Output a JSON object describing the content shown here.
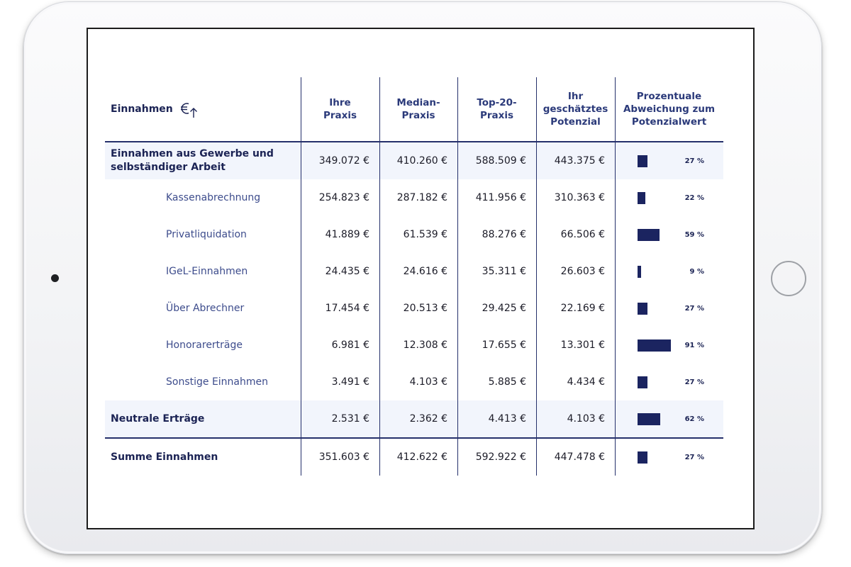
{
  "table": {
    "headers": {
      "first": "Einnahmen",
      "icon": "euro-up-arrow-icon",
      "columns": [
        [
          "Ihre",
          "Praxis"
        ],
        [
          "Median-",
          "Praxis"
        ],
        [
          "Top-20-",
          "Praxis"
        ],
        [
          "Ihr",
          "geschätztes",
          "Potenzial"
        ],
        [
          "Prozentuale",
          "Abweichung zum",
          "Potenzialwert"
        ]
      ]
    },
    "rows": [
      {
        "label": "Einnahmen aus Gewerbe und selbständiger Arbeit",
        "type": "group",
        "values": [
          "349.072 €",
          "410.260 €",
          "588.509 €",
          "443.375 €"
        ],
        "pct_value": 27,
        "pct": "27 %"
      },
      {
        "label": "Kassenabrechnung",
        "type": "sub",
        "values": [
          "254.823 €",
          "287.182 €",
          "411.956 €",
          "310.363 €"
        ],
        "pct_value": 22,
        "pct": "22 %"
      },
      {
        "label": "Privatliquidation",
        "type": "sub",
        "values": [
          "41.889 €",
          "61.539 €",
          "88.276 €",
          "66.506 €"
        ],
        "pct_value": 59,
        "pct": "59 %"
      },
      {
        "label": "IGeL-Einnahmen",
        "type": "sub",
        "values": [
          "24.435 €",
          "24.616 €",
          "35.311 €",
          "26.603 €"
        ],
        "pct_value": 9,
        "pct": "9 %"
      },
      {
        "label": "Über Abrechner",
        "type": "sub",
        "values": [
          "17.454 €",
          "20.513 €",
          "29.425 €",
          "22.169 €"
        ],
        "pct_value": 27,
        "pct": "27 %"
      },
      {
        "label": "Honorarerträge",
        "type": "sub",
        "values": [
          "6.981 €",
          "12.308 €",
          "17.655 €",
          "13.301 €"
        ],
        "pct_value": 91,
        "pct": "91 %"
      },
      {
        "label": "Sonstige Einnahmen",
        "type": "sub",
        "values": [
          "3.491 €",
          "4.103 €",
          "5.885 €",
          "4.434 €"
        ],
        "pct_value": 27,
        "pct": "27 %"
      },
      {
        "label": "Neutrale Erträge",
        "type": "group",
        "values": [
          "2.531 €",
          "2.362 €",
          "4.413 €",
          "4.103 €"
        ],
        "pct_value": 62,
        "pct": "62 %"
      },
      {
        "label": "Summe Einnahmen",
        "type": "total",
        "values": [
          "351.603 €",
          "412.622 €",
          "592.922 €",
          "447.478 €"
        ],
        "pct_value": 27,
        "pct": "27 %"
      }
    ]
  },
  "colors": {
    "navy": "#1b2460",
    "highlight": "#f2f5fc",
    "sub_label": "#3d4c8c"
  }
}
